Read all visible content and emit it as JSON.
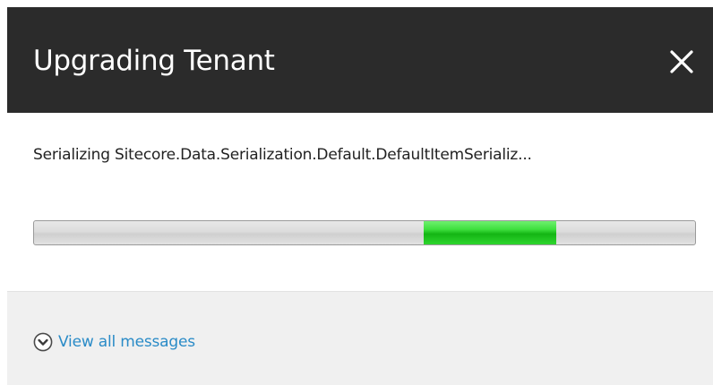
{
  "dialog": {
    "title": "Upgrading Tenant",
    "close_icon": "close-icon"
  },
  "status": {
    "message": "Serializing Sitecore.Data.Serialization.Default.DefaultItemSerializ..."
  },
  "progress": {
    "mode": "indeterminate",
    "chunk_start_fraction": 0.59,
    "chunk_end_fraction": 0.79,
    "chunk_color": "#1fc71f",
    "track_color": "#dcdcdc"
  },
  "footer": {
    "toggle_icon": "chevron-down-circle-icon",
    "view_all_label": "View all messages",
    "link_color": "#2a8bc7"
  }
}
